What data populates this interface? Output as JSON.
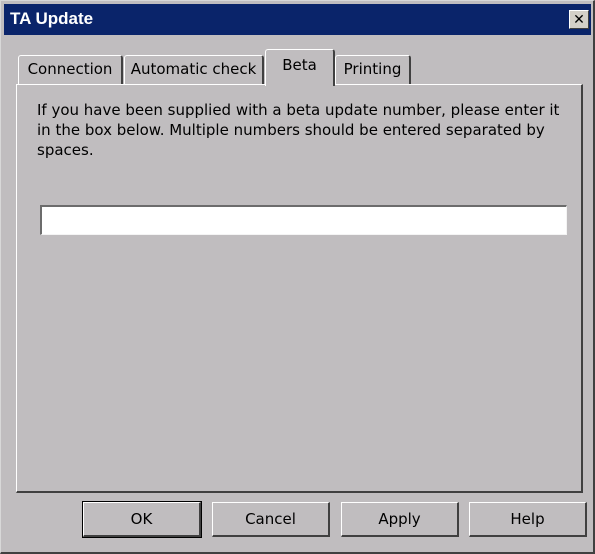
{
  "window": {
    "title": "TA Update",
    "close_glyph": "✕",
    "close_icon": "close-icon"
  },
  "tabs": [
    {
      "label": "Connection",
      "active": false
    },
    {
      "label": "Automatic check",
      "active": false
    },
    {
      "label": "Beta",
      "active": true
    },
    {
      "label": "Printing",
      "active": false
    }
  ],
  "beta": {
    "instructions": "If you have been supplied with a beta update number, please enter it in the box below. Multiple numbers should be entered separated by spaces.",
    "input_value": ""
  },
  "buttons": {
    "ok": "OK",
    "cancel": "Cancel",
    "apply": "Apply",
    "help": "Help"
  },
  "colors": {
    "titlebar": "#0a246a",
    "face": "#c0bdbf"
  }
}
